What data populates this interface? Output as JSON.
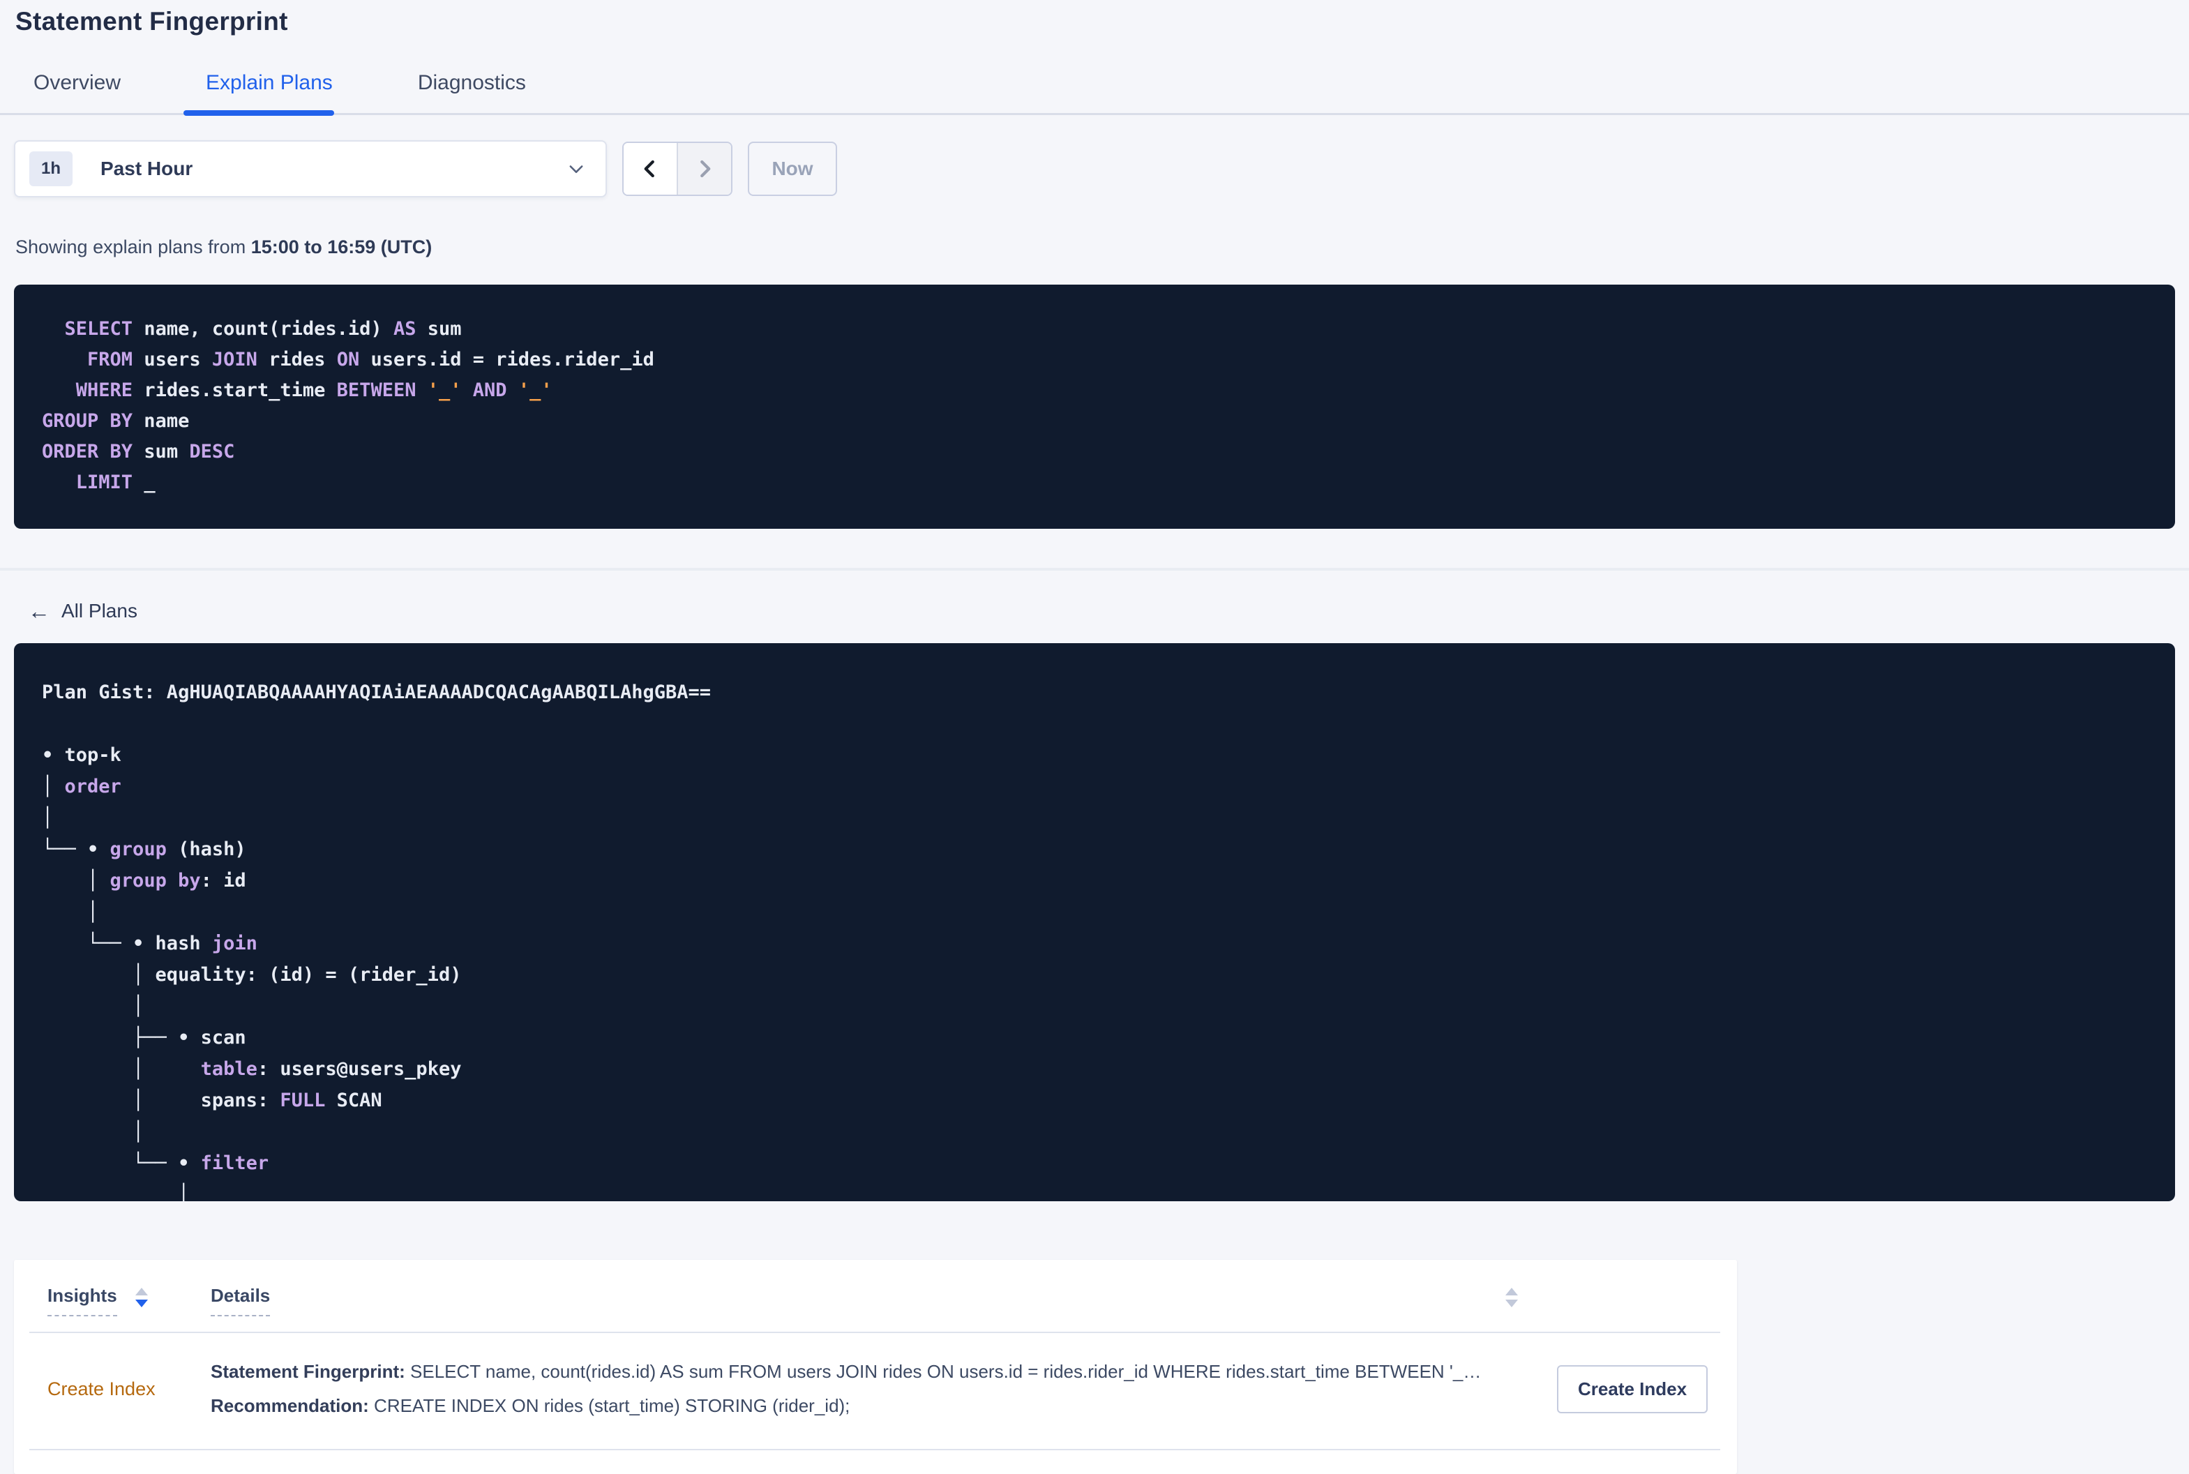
{
  "page": {
    "title": "Statement Fingerprint"
  },
  "tabs": [
    {
      "label": "Overview",
      "active": false
    },
    {
      "label": "Explain Plans",
      "active": true
    },
    {
      "label": "Diagnostics",
      "active": false
    }
  ],
  "time": {
    "range_badge": "1h",
    "range_label": "Past Hour",
    "now_label": "Now"
  },
  "showing": {
    "prefix": "Showing explain plans from ",
    "range": "15:00 to 16:59 (UTC)"
  },
  "colors": {
    "accent_blue": "#2161eb",
    "code_background": "#101b2e",
    "code_keyword_purple": "#c7a7ea",
    "code_text_white": "#e8ecf4",
    "code_placeholder_orange": "#f6a04b",
    "insight_link_orange": "#b5690f"
  },
  "sql": {
    "lines": [
      [
        {
          "c": "t",
          "s": "  "
        },
        {
          "c": "k",
          "s": "SELECT"
        },
        {
          "c": "t",
          "s": " name, count(rides.id) "
        },
        {
          "c": "k",
          "s": "AS"
        },
        {
          "c": "t",
          "s": " sum"
        }
      ],
      [
        {
          "c": "t",
          "s": "    "
        },
        {
          "c": "k",
          "s": "FROM"
        },
        {
          "c": "t",
          "s": " users "
        },
        {
          "c": "k",
          "s": "JOIN"
        },
        {
          "c": "t",
          "s": " rides "
        },
        {
          "c": "k",
          "s": "ON"
        },
        {
          "c": "t",
          "s": " users.id = rides.rider_id"
        }
      ],
      [
        {
          "c": "t",
          "s": "   "
        },
        {
          "c": "k",
          "s": "WHERE"
        },
        {
          "c": "t",
          "s": " rides.start_time "
        },
        {
          "c": "k",
          "s": "BETWEEN"
        },
        {
          "c": "t",
          "s": " "
        },
        {
          "c": "o",
          "s": "'_'"
        },
        {
          "c": "t",
          "s": " "
        },
        {
          "c": "k",
          "s": "AND"
        },
        {
          "c": "t",
          "s": " "
        },
        {
          "c": "o",
          "s": "'_'"
        }
      ],
      [
        {
          "c": "k",
          "s": "GROUP BY"
        },
        {
          "c": "t",
          "s": " name"
        }
      ],
      [
        {
          "c": "k",
          "s": "ORDER BY"
        },
        {
          "c": "t",
          "s": " sum "
        },
        {
          "c": "k",
          "s": "DESC"
        }
      ],
      [
        {
          "c": "t",
          "s": "   "
        },
        {
          "c": "k",
          "s": "LIMIT"
        },
        {
          "c": "t",
          "s": " _"
        }
      ]
    ]
  },
  "all_plans": {
    "label": "All Plans"
  },
  "plan": {
    "gist_label": "Plan Gist:",
    "gist": "AgHUAQIABQAAAAHYAQIAiAEAAAADCQACAgAABQILAhgGBA==",
    "lines": [
      [
        {
          "c": "t",
          "s": "Plan Gist: AgHUAQIABQAAAAHYAQIAiAEAAAADCQACAgAABQILAhgGBA=="
        }
      ],
      [],
      [
        {
          "c": "t",
          "s": "• top-k"
        }
      ],
      [
        {
          "c": "t",
          "s": "│ "
        },
        {
          "c": "k",
          "s": "order"
        }
      ],
      [
        {
          "c": "t",
          "s": "│"
        }
      ],
      [
        {
          "c": "t",
          "s": "└── • "
        },
        {
          "c": "k",
          "s": "group"
        },
        {
          "c": "t",
          "s": " (hash)"
        }
      ],
      [
        {
          "c": "t",
          "s": "    │ "
        },
        {
          "c": "k",
          "s": "group by"
        },
        {
          "c": "t",
          "s": ": id"
        }
      ],
      [
        {
          "c": "t",
          "s": "    │"
        }
      ],
      [
        {
          "c": "t",
          "s": "    └── • hash "
        },
        {
          "c": "k",
          "s": "join"
        }
      ],
      [
        {
          "c": "t",
          "s": "        │ equality: (id) = (rider_id)"
        }
      ],
      [
        {
          "c": "t",
          "s": "        │"
        }
      ],
      [
        {
          "c": "t",
          "s": "        ├── • scan"
        }
      ],
      [
        {
          "c": "t",
          "s": "        │     "
        },
        {
          "c": "k",
          "s": "table"
        },
        {
          "c": "t",
          "s": ": users@users_pkey"
        }
      ],
      [
        {
          "c": "t",
          "s": "        │     spans: "
        },
        {
          "c": "k",
          "s": "FULL"
        },
        {
          "c": "t",
          "s": " SCAN"
        }
      ],
      [
        {
          "c": "t",
          "s": "        │"
        }
      ],
      [
        {
          "c": "t",
          "s": "        └── • "
        },
        {
          "c": "k",
          "s": "filter"
        }
      ],
      [
        {
          "c": "t",
          "s": "            │"
        }
      ]
    ]
  },
  "insights_table": {
    "headers": [
      "Insights",
      "Details"
    ],
    "rows": [
      {
        "insight_label": "Create Index",
        "details": [
          {
            "label": "Statement Fingerprint:",
            "text": " SELECT name, count(rides.id) AS sum FROM users JOIN rides ON users.id = rides.rider_id WHERE rides.start_time BETWEEN '_…"
          },
          {
            "label": "Recommendation:",
            "text": " CREATE INDEX ON rides (start_time) STORING (rider_id);"
          }
        ],
        "action_label": "Create Index"
      }
    ]
  }
}
